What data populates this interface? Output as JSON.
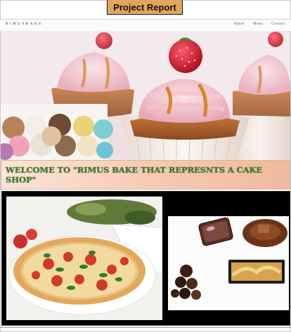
{
  "badge": {
    "label": "Project Report"
  },
  "nav": {
    "logo": "RIMUSBAKE",
    "menu": [
      "About",
      "Menu",
      "Contact"
    ]
  },
  "welcome": {
    "text": "Welcome to \"Rimus Bake that represnts a cake shop\""
  },
  "colors": {
    "badge_bg": "#e0a65a",
    "welcome_text": "#3e7d2d",
    "welcome_bg": "#f6c9b2",
    "gallery_bg": "#000000"
  },
  "images": {
    "hero": "cupcakes-with-raspberries-and-ice-cream-scoops",
    "gallery_left": "pizza-with-tomatoes-and-basil",
    "gallery_right": "chocolate-desserts-and-pastry"
  }
}
